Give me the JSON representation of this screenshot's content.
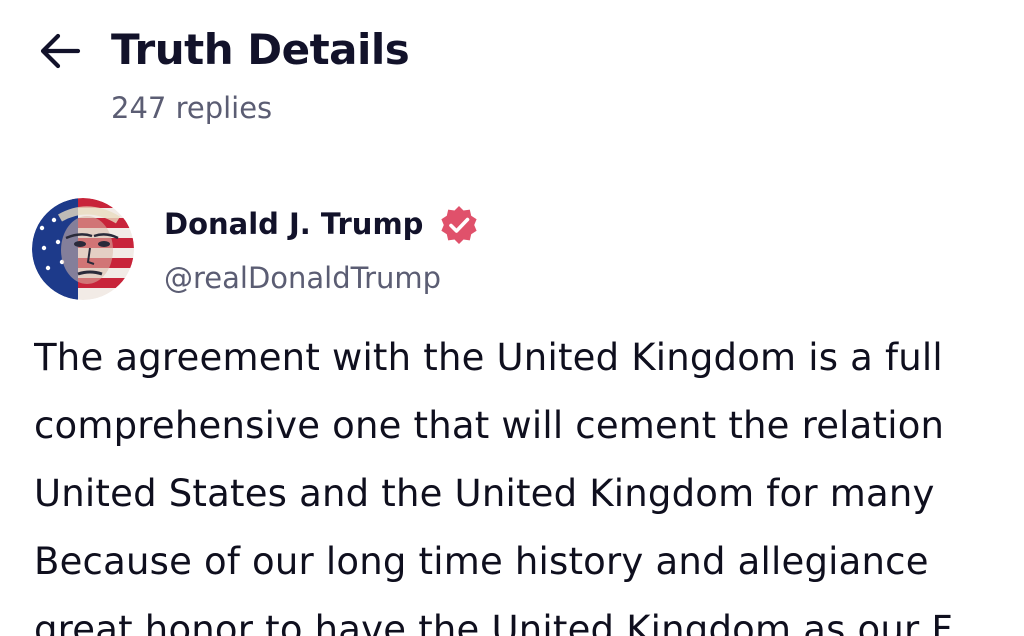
{
  "header": {
    "title": "Truth Details",
    "reply_count": "247 replies",
    "back_icon": "arrow-left-icon"
  },
  "post": {
    "author": {
      "display_name": "Donald J. Trump",
      "handle": "@realDonaldTrump",
      "verified": true,
      "verified_icon": "verified-check-icon",
      "verified_color": "#e0516b"
    },
    "body_lines": [
      "The agreement with the United Kingdom is a full",
      "comprehensive one that will cement the relation",
      "United States and the United Kingdom for many",
      "Because of our long time history and allegiance",
      "great honor to have the United Kingdom as our F"
    ]
  }
}
